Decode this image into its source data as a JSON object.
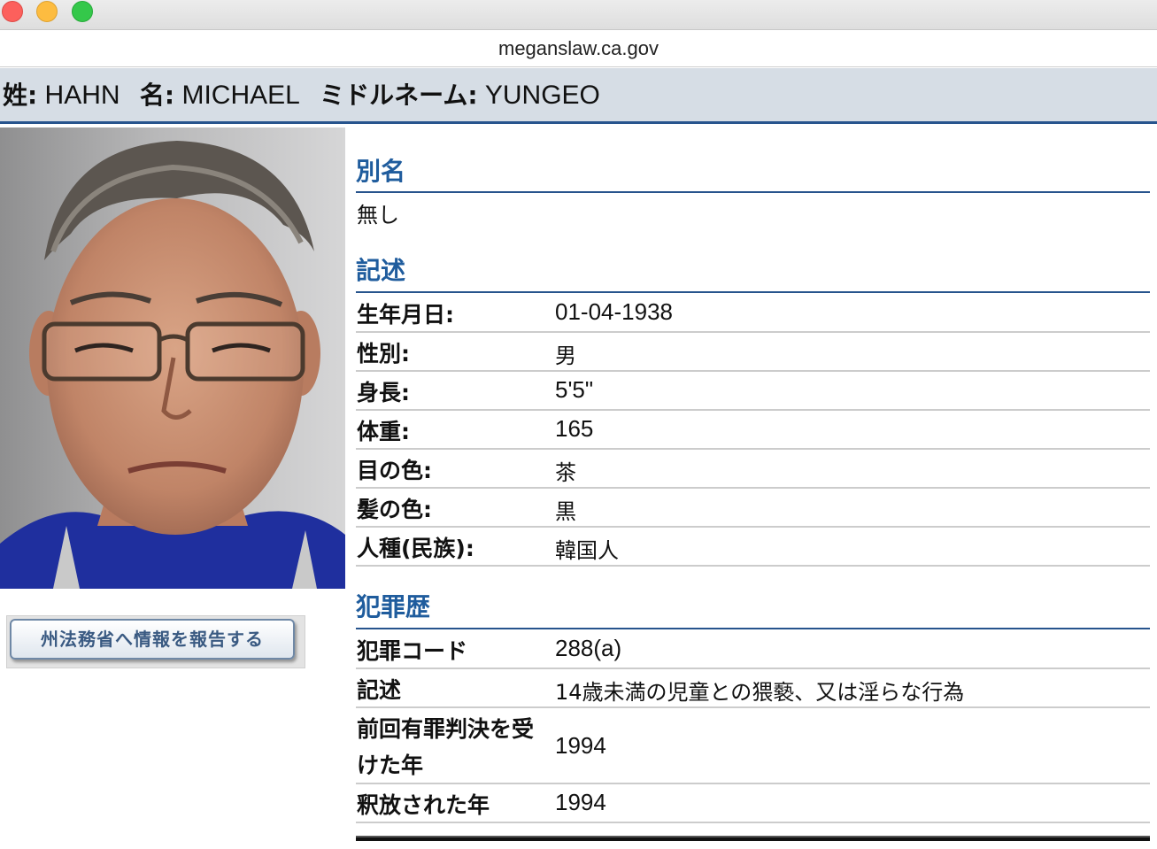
{
  "browser": {
    "url": "meganslaw.ca.gov"
  },
  "name_bar": {
    "last_label": "姓:",
    "last_value": "HAHN",
    "first_label": "名:",
    "first_value": "MICHAEL",
    "middle_label": "ミドルネーム:",
    "middle_value": "YUNGEO"
  },
  "report_button": {
    "label": "州法務省へ情報を報告する"
  },
  "aliases": {
    "title": "別名",
    "value": "無し"
  },
  "description": {
    "title": "記述",
    "rows": [
      {
        "label": "生年月日:",
        "value": "01-04-1938"
      },
      {
        "label": "性別:",
        "value": "男"
      },
      {
        "label": "身長:",
        "value": "5'5\""
      },
      {
        "label": "体重:",
        "value": "165"
      },
      {
        "label": "目の色:",
        "value": "茶"
      },
      {
        "label": "髪の色:",
        "value": "黒"
      },
      {
        "label": "人種(民族):",
        "value": "韓国人"
      }
    ]
  },
  "offenses": {
    "title": "犯罪歴",
    "rows": [
      {
        "label": "犯罪コード",
        "value": "288(a)"
      },
      {
        "label": "記述",
        "value": "14歳未満の児童との猥褻、又は淫らな行為"
      },
      {
        "label_line1": "前回有罪判決を受",
        "label_line2": "けた年",
        "value": "1994"
      },
      {
        "label": "釈放された年",
        "value": "1994"
      }
    ]
  }
}
